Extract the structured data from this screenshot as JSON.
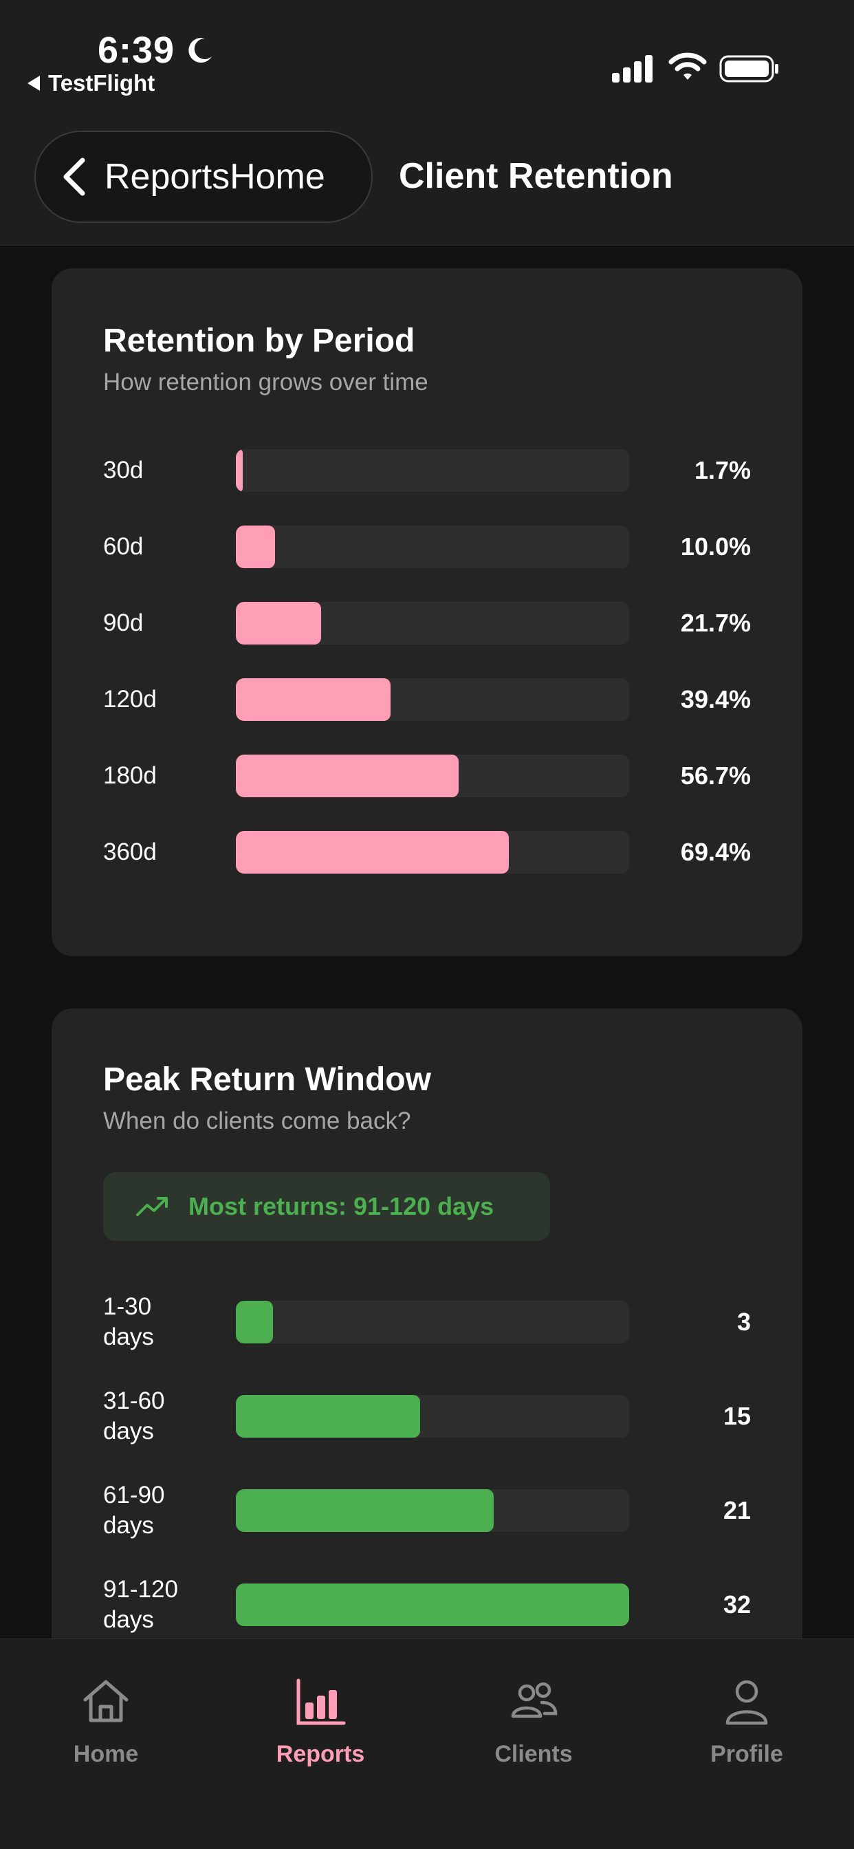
{
  "status": {
    "time": "6:39",
    "back_app": "TestFlight"
  },
  "nav": {
    "back_label": "ReportsHome",
    "title": "Client Retention"
  },
  "retention": {
    "title": "Retention by Period",
    "subtitle": "How retention grows over time",
    "rows": [
      {
        "label": "30d",
        "value": "1.7%",
        "pct": 1.7
      },
      {
        "label": "60d",
        "value": "10.0%",
        "pct": 10.0
      },
      {
        "label": "90d",
        "value": "21.7%",
        "pct": 21.7
      },
      {
        "label": "120d",
        "value": "39.4%",
        "pct": 39.4
      },
      {
        "label": "180d",
        "value": "56.7%",
        "pct": 56.7
      },
      {
        "label": "360d",
        "value": "69.4%",
        "pct": 69.4
      }
    ]
  },
  "peak": {
    "title": "Peak Return Window",
    "subtitle": "When do clients come back?",
    "insight": "Most returns: 91-120 days",
    "max": 32,
    "rows": [
      {
        "label_top": "1-30",
        "label_bottom": "days",
        "value": "3",
        "count": 3
      },
      {
        "label_top": "31-60",
        "label_bottom": "days",
        "value": "15",
        "count": 15
      },
      {
        "label_top": "61-90",
        "label_bottom": "days",
        "value": "21",
        "count": 21
      },
      {
        "label_top": "91-120",
        "label_bottom": "days",
        "value": "32",
        "count": 32
      }
    ]
  },
  "tabs": [
    {
      "label": "Home",
      "icon": "home-icon",
      "active": false
    },
    {
      "label": "Reports",
      "icon": "reports-icon",
      "active": true
    },
    {
      "label": "Clients",
      "icon": "clients-icon",
      "active": false
    },
    {
      "label": "Profile",
      "icon": "profile-icon",
      "active": false
    }
  ],
  "colors": {
    "accent_pink": "#ff9eb6",
    "accent_green": "#4caf50",
    "inactive_tab": "#8a8a8a"
  }
}
